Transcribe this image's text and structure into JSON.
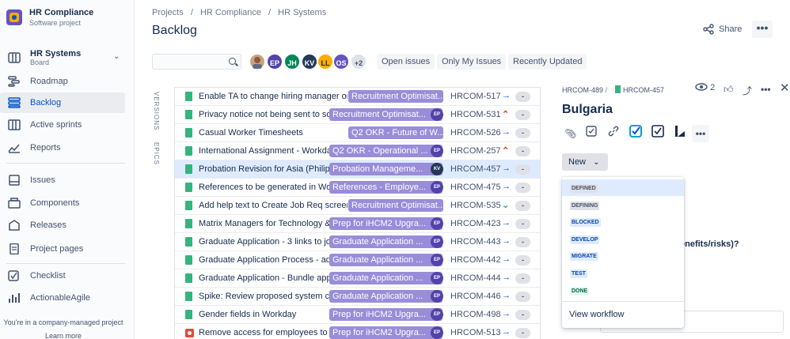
{
  "sidebar": {
    "project_name": "HR Compliance",
    "project_type": "Software project",
    "board_name": "HR Systems",
    "board_sub": "Board",
    "items": [
      {
        "label": "Roadmap",
        "icon": "roadmap-icon"
      },
      {
        "label": "Backlog",
        "icon": "backlog-icon"
      },
      {
        "label": "Active sprints",
        "icon": "active-sprints-icon"
      },
      {
        "label": "Reports",
        "icon": "reports-icon"
      }
    ],
    "items2": [
      {
        "label": "Issues",
        "icon": "issues-icon"
      },
      {
        "label": "Components",
        "icon": "components-icon"
      },
      {
        "label": "Releases",
        "icon": "releases-icon"
      },
      {
        "label": "Project pages",
        "icon": "project-pages-icon"
      }
    ],
    "items3": [
      {
        "label": "Checklist",
        "icon": "checklist-icon"
      },
      {
        "label": "ActionableAgile",
        "icon": "actionableagile-icon"
      }
    ],
    "footer_text": "You're in a company-managed project",
    "learn_more": "Learn more"
  },
  "breadcrumbs": [
    "Projects",
    "/",
    "HR Compliance",
    "/",
    "HR Systems"
  ],
  "page_title": "Backlog",
  "share_label": "Share",
  "more_label": "•••",
  "filter": {
    "search_placeholder": "",
    "avatars": [
      "",
      "EP",
      "JH",
      "KV",
      "LL",
      "OS"
    ],
    "avatar_more": "+2",
    "buttons": [
      "Open issues",
      "Only My Issues",
      "Recently Updated"
    ]
  },
  "side_labels": [
    "VERSIONS",
    "EPICS"
  ],
  "issues": [
    {
      "summary": "Enable TA to change hiring manager on Jo",
      "epic": "Recruitment Optimisat...",
      "assignee": "",
      "key": "HRCOM-517",
      "priority": "→",
      "est": "-",
      "type": "story"
    },
    {
      "summary": "Privacy notice not being sent to som",
      "epic": "Recruitment Optimisat...",
      "assignee": "EP",
      "key": "HRCOM-531",
      "priority": "⌃",
      "est": "-",
      "type": "story"
    },
    {
      "summary": "Casual Worker Timesheets",
      "epic": "Q2 OKR - Future of W...",
      "assignee": "",
      "key": "HRCOM-526",
      "priority": "→",
      "est": "-",
      "type": "story"
    },
    {
      "summary": "International Assignment - Workday",
      "epic": "Q2 OKR - Operational ...",
      "assignee": "EP",
      "key": "HRCOM-257",
      "priority": "⌃",
      "est": "-",
      "type": "story"
    },
    {
      "summary": "Probation Revision for Asia (Philippir",
      "epic": "Probation Manageme...",
      "assignee": "KV",
      "key": "HRCOM-457",
      "priority": "→",
      "est": "-",
      "type": "story"
    },
    {
      "summary": "References to be generated in Work",
      "epic": "References - Employe...",
      "assignee": "EP",
      "key": "HRCOM-475",
      "priority": "→",
      "est": "-",
      "type": "story"
    },
    {
      "summary": "Add help text to Create Job Req screen -",
      "epic": "Recruitment Optimisat...",
      "assignee": "",
      "key": "HRCOM-535",
      "priority": "⌄",
      "est": "-",
      "type": "story"
    },
    {
      "summary": "Matrix Managers for Technology & F",
      "epic": "Prep for iHCM2 Upgra...",
      "assignee": "EP",
      "key": "HRCOM-423",
      "priority": "→",
      "est": "-",
      "type": "story"
    },
    {
      "summary": "Graduate Application - 3 links to jou",
      "epic": "Graduate Application ...",
      "assignee": "EP",
      "key": "HRCOM-443",
      "priority": "→",
      "est": "-",
      "type": "story"
    },
    {
      "summary": "Graduate Application Process - add",
      "epic": "Graduate Application ...",
      "assignee": "EP",
      "key": "HRCOM-442",
      "priority": "→",
      "est": "-",
      "type": "story"
    },
    {
      "summary": "Graduate Application - Bundle appli",
      "epic": "Graduate Application ...",
      "assignee": "EP",
      "key": "HRCOM-444",
      "priority": "→",
      "est": "-",
      "type": "story"
    },
    {
      "summary": "Spike: Review proposed system cap",
      "epic": "Graduate Application ...",
      "assignee": "EP",
      "key": "HRCOM-446",
      "priority": "→",
      "est": "-",
      "type": "story"
    },
    {
      "summary": "Gender fields in Workday",
      "epic": "Prep for iHCM2 Upgra...",
      "assignee": "EP",
      "key": "HRCOM-498",
      "priority": "→",
      "est": "-",
      "type": "story"
    },
    {
      "summary": "Remove access for employees to change",
      "epic": "Prep for iHCM2 Upgra...",
      "assignee": "EP",
      "key": "HRCOM-513",
      "priority": "→",
      "est": "-",
      "type": "bug"
    }
  ],
  "detail": {
    "parent_key": "HRCOM-489",
    "issue_key": "HRCOM-457",
    "watch_count": "2",
    "title": "Bulgaria",
    "status_button": "New",
    "status_options": [
      {
        "label": "DEFINED",
        "bg": "#dfe1e6",
        "fg": "#42526e"
      },
      {
        "label": "DEFINING",
        "bg": "#dfe1e6",
        "fg": "#42526e"
      },
      {
        "label": "BLOCKED",
        "bg": "#deebff",
        "fg": "#0747a6"
      },
      {
        "label": "DEVELOP",
        "bg": "#deebff",
        "fg": "#0747a6"
      },
      {
        "label": "MIGRATE",
        "bg": "#deebff",
        "fg": "#0747a6"
      },
      {
        "label": "TEST",
        "bg": "#deebff",
        "fg": "#0747a6"
      },
      {
        "label": "DONE",
        "bg": "#e3fcef",
        "fg": "#006644"
      }
    ],
    "view_workflow": "View workflow",
    "question_fragment": "enefits/risks)?"
  },
  "colors": {
    "accent": "#0052cc",
    "epic_bg": "#998dd9",
    "story_green": "#36b37e",
    "selected_row": "#deebff"
  }
}
